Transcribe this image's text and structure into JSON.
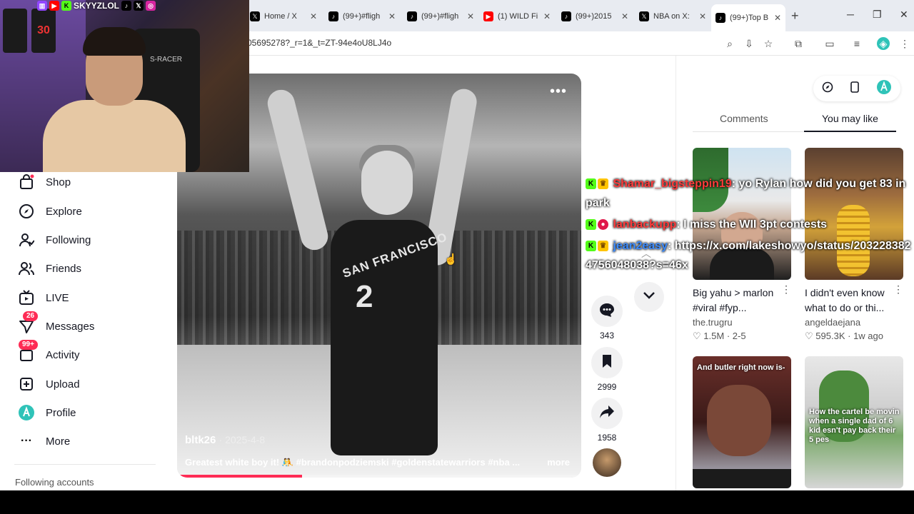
{
  "browser": {
    "tabs": [
      {
        "label": "Home / X",
        "icon": "x-icon",
        "color": "#000000"
      },
      {
        "label": "(99+)#fligh",
        "icon": "tiktok-icon",
        "color": "#000000"
      },
      {
        "label": "(99+)#fligh",
        "icon": "tiktok-icon",
        "color": "#000000"
      },
      {
        "label": "(1) WILD Fi",
        "icon": "youtube-icon",
        "color": "#ff0000"
      },
      {
        "label": "(99+)2015",
        "icon": "tiktok-icon",
        "color": "#000000"
      },
      {
        "label": "NBA on X:",
        "icon": "x-icon",
        "color": "#000000"
      },
      {
        "label": "(99+)Top B",
        "icon": "tiktok-icon",
        "color": "#000000"
      }
    ],
    "url": "05695278?_r=1&_t=ZT-94e4oU8LJ4o"
  },
  "webcam": {
    "streamer_name": "SKYYZLOL",
    "chair_text": "S-RACER",
    "jersey_number": "30"
  },
  "sidebar": {
    "items": [
      {
        "label": "Shop",
        "icon": "shop-bag-icon",
        "badge": ""
      },
      {
        "label": "Explore",
        "icon": "compass-icon",
        "badge": ""
      },
      {
        "label": "Following",
        "icon": "following-user-icon",
        "badge": ""
      },
      {
        "label": "Friends",
        "icon": "friends-icon",
        "badge": ""
      },
      {
        "label": "LIVE",
        "icon": "live-tv-icon",
        "badge": ""
      },
      {
        "label": "Messages",
        "icon": "messages-send-icon",
        "badge": "26"
      },
      {
        "label": "Activity",
        "icon": "activity-inbox-icon",
        "badge": "99+"
      },
      {
        "label": "Upload",
        "icon": "upload-plus-icon",
        "badge": ""
      },
      {
        "label": "Profile",
        "icon": "profile-avatar-icon",
        "badge": ""
      },
      {
        "label": "More",
        "icon": "more-dots-icon",
        "badge": ""
      }
    ],
    "following_accounts": "Following accounts"
  },
  "video": {
    "author": "bltk26",
    "date": "2025-4-8",
    "caption": "Greatest white boy it! 🤼 #brandonpodziemski #goldenstatewarriors #nba ...",
    "more": "more",
    "jersey_text": "SAN FRANCISCO",
    "jersey_number": "2",
    "progress": 0.31
  },
  "actions": {
    "comments": "343",
    "saves": "2999",
    "shares": "1958"
  },
  "chat": [
    {
      "user": "Shamar_bigsteppin19",
      "user_color": "#ff3b3b",
      "message": ": yo Rylan how did you get 83 in park"
    },
    {
      "user": "lanbackupp",
      "user_color": "#ff3b3b",
      "message": ": I miss the WII 3pt contests"
    },
    {
      "user": "jean2easy",
      "user_color": "#3b8bff",
      "message": ": https://x.com/lakeshowyo/status/2032283824756048038?s=46x"
    }
  ],
  "right_panel": {
    "tab_comments": "Comments",
    "tab_you_may_like": "You may like",
    "cards": [
      {
        "title": "Big yahu > marlon #viral #fyp...",
        "author": "the.trugru",
        "likes": "1.5M",
        "date": "2-5",
        "thumb_text": ""
      },
      {
        "title": "I didn't even know what to do or thi...",
        "author": "angeldaejana",
        "likes": "595.3K",
        "date": "1w ago",
        "thumb_text": ""
      },
      {
        "title": "",
        "author": "",
        "likes": "",
        "date": "",
        "thumb_text": "And butler right now is-"
      },
      {
        "title": "",
        "author": "",
        "likes": "",
        "date": "",
        "thumb_text": "How the cartel be movin when a single dad of 6 kid esn't pay back their 5 pes"
      }
    ]
  }
}
